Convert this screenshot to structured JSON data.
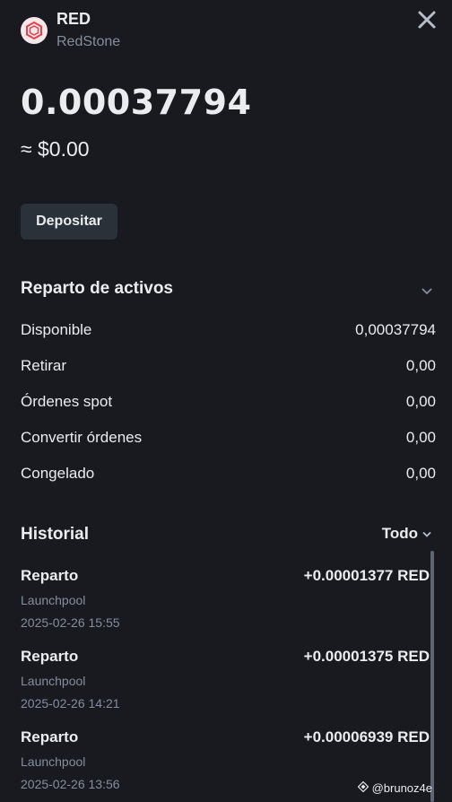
{
  "coin": {
    "symbol": "RED",
    "name": "RedStone",
    "logo_icon": "redstone-hexagon-icon",
    "logo_color": "#e2434b"
  },
  "balance": {
    "amount": "0.00037794",
    "usd": "≈ $0.00"
  },
  "actions": {
    "deposit_label": "Depositar"
  },
  "allocation": {
    "title": "Reparto de activos",
    "rows": [
      {
        "label": "Disponible",
        "value": "0,00037794"
      },
      {
        "label": "Retirar",
        "value": "0,00"
      },
      {
        "label": "Órdenes spot",
        "value": "0,00"
      },
      {
        "label": "Convertir órdenes",
        "value": "0,00"
      },
      {
        "label": "Congelado",
        "value": "0,00"
      }
    ]
  },
  "history": {
    "title": "Historial",
    "filter_label": "Todo",
    "items": [
      {
        "type": "Reparto",
        "source": "Launchpool",
        "time": "2025-02-26 15:55",
        "amount": "+0.00001377 RED"
      },
      {
        "type": "Reparto",
        "source": "Launchpool",
        "time": "2025-02-26 14:21",
        "amount": "+0.00001375 RED"
      },
      {
        "type": "Reparto",
        "source": "Launchpool",
        "time": "2025-02-26 13:56",
        "amount": "+0.00006939 RED"
      }
    ]
  },
  "watermark": {
    "text": "@brunoz4e"
  },
  "colors": {
    "background": "#181a20",
    "surface": "#2b3139",
    "text_primary": "#eaecef",
    "text_secondary": "#848e9c"
  }
}
